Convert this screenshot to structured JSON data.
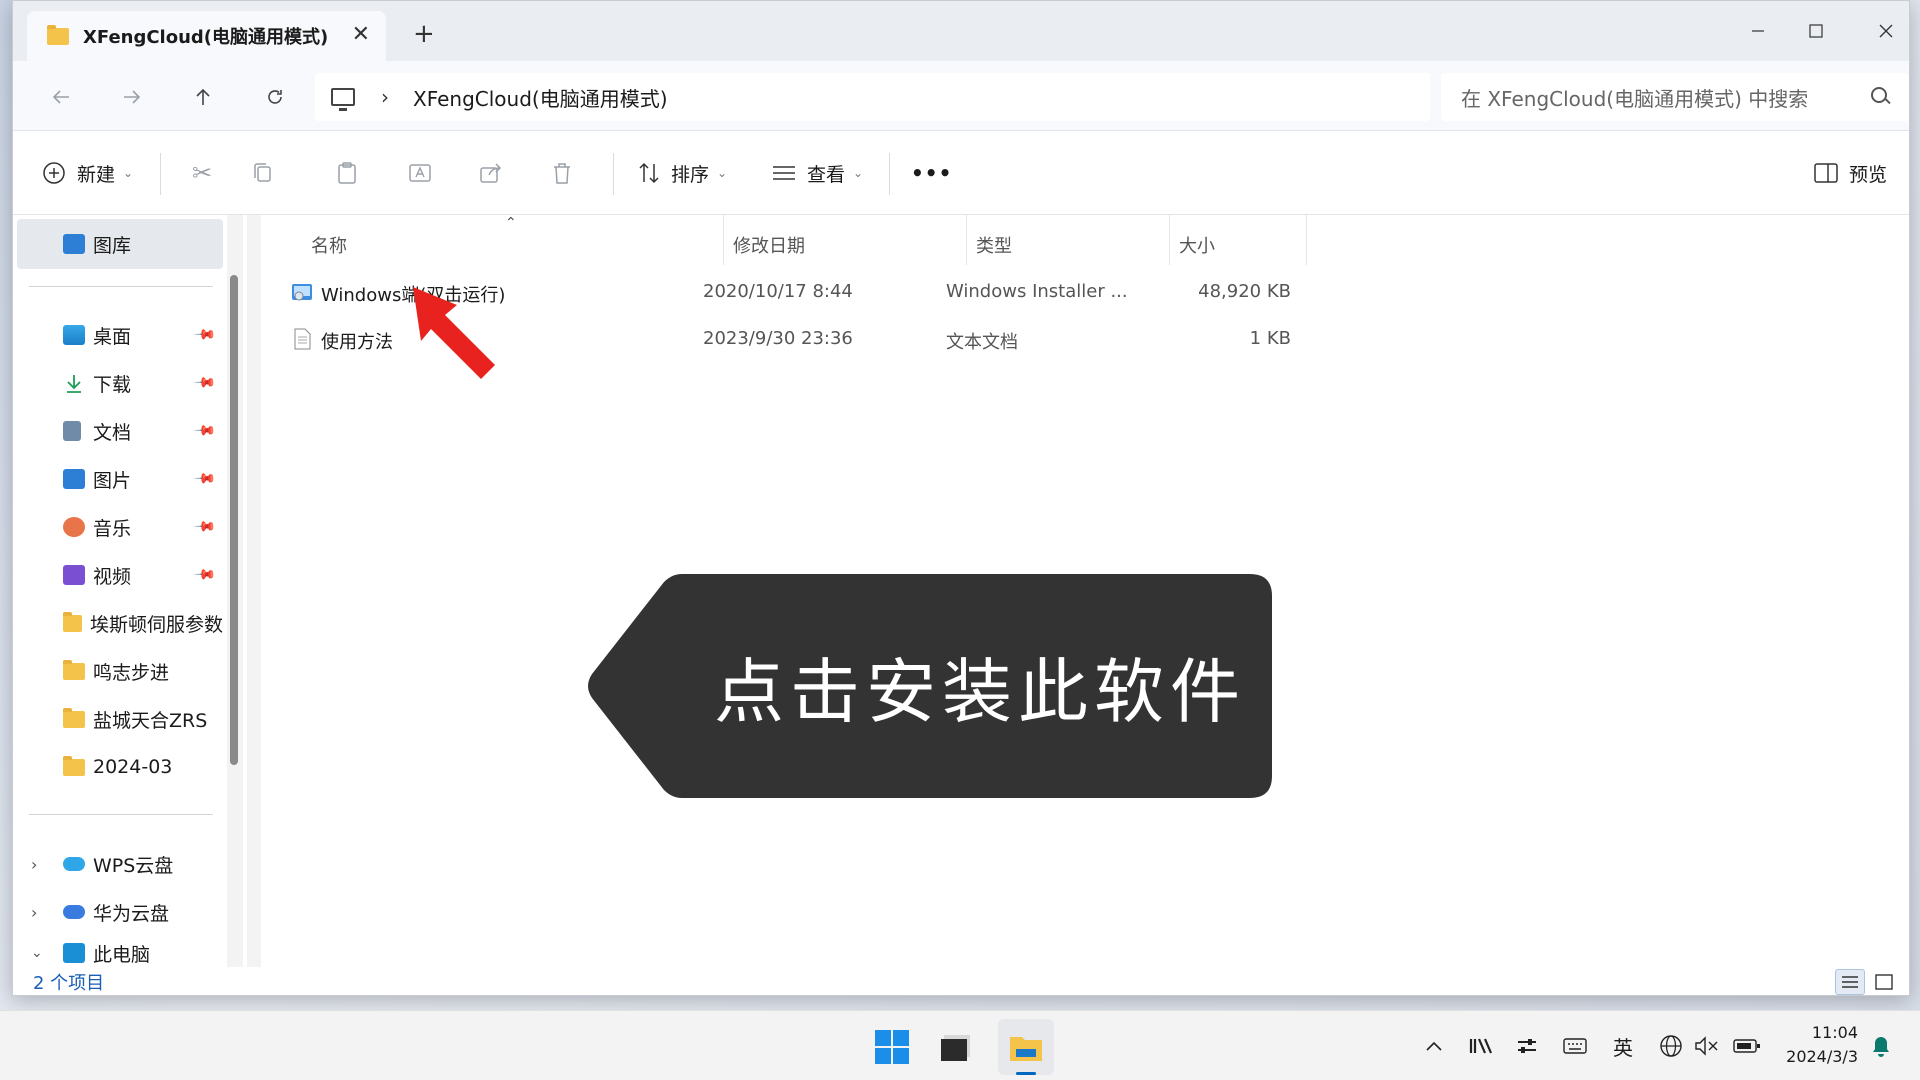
{
  "window": {
    "tab_title": "XFengCloud(电脑通用模式)",
    "tab_close": "✕",
    "new_tab": "+"
  },
  "nav": {
    "breadcrumb": "XFengCloud(电脑通用模式)",
    "search_placeholder": "在 XFengCloud(电脑通用模式) 中搜索"
  },
  "toolbar": {
    "new_label": "新建",
    "sort_label": "排序",
    "view_label": "查看",
    "more_label": "•••",
    "preview_label": "预览"
  },
  "sidebar": {
    "gallery": "图库",
    "items": [
      {
        "label": "桌面",
        "icon": "desktop-icon",
        "pinned": true
      },
      {
        "label": "下载",
        "icon": "download-icon",
        "pinned": true
      },
      {
        "label": "文档",
        "icon": "document-icon",
        "pinned": true
      },
      {
        "label": "图片",
        "icon": "pictures-icon",
        "pinned": true
      },
      {
        "label": "音乐",
        "icon": "music-icon",
        "pinned": true
      },
      {
        "label": "视频",
        "icon": "video-icon",
        "pinned": true
      },
      {
        "label": "埃斯顿伺服参数",
        "icon": "folder-icon",
        "pinned": false
      },
      {
        "label": "鸣志步进",
        "icon": "folder-icon",
        "pinned": false
      },
      {
        "label": "盐城天合ZRS",
        "icon": "folder-icon",
        "pinned": false
      },
      {
        "label": "2024-03",
        "icon": "folder-icon",
        "pinned": false
      }
    ],
    "cloud": [
      {
        "label": "WPS云盘",
        "icon": "cloud-icon"
      },
      {
        "label": "华为云盘",
        "icon": "cloud-icon"
      },
      {
        "label": "此电脑",
        "icon": "pc-icon"
      }
    ]
  },
  "columns": {
    "name": "名称",
    "date": "修改日期",
    "type": "类型",
    "size": "大小"
  },
  "files": [
    {
      "name": "Windows端(双击运行)",
      "date": "2020/10/17 8:44",
      "type": "Windows Installer ...",
      "size": "48,920 KB",
      "icon": "installer-icon"
    },
    {
      "name": "使用方法",
      "date": "2023/9/30 23:36",
      "type": "文本文档",
      "size": "1 KB",
      "icon": "text-file-icon"
    }
  ],
  "callout": {
    "text": "点击安装此软件"
  },
  "status": {
    "item_count": "2 个项目"
  },
  "taskbar": {
    "ime": "英",
    "time": "11:04",
    "date": "2024/3/3"
  },
  "colors": {
    "accent": "#0067c0",
    "callout_bg": "#333333",
    "arrow_red": "#e8231f",
    "folder": "#f3c34a"
  }
}
